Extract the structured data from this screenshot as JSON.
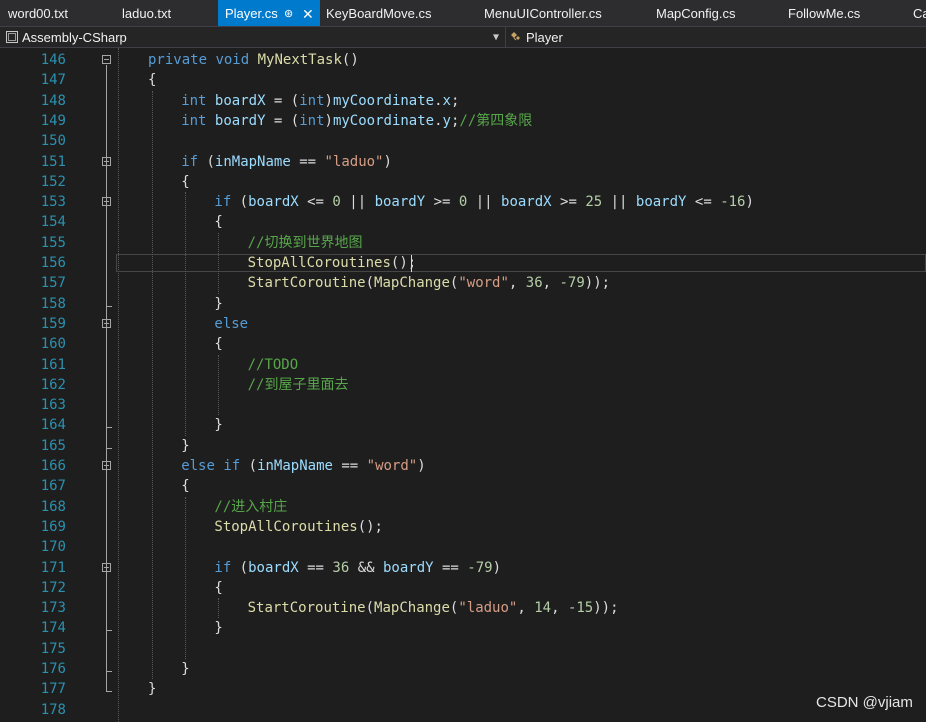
{
  "tabs": [
    {
      "label": "word00.txt",
      "active": false
    },
    {
      "label": "laduo.txt",
      "active": false
    },
    {
      "label": "Player.cs",
      "active": true
    },
    {
      "label": "KeyBoardMove.cs",
      "active": false
    },
    {
      "label": "MenuUIController.cs",
      "active": false
    },
    {
      "label": "MapConfig.cs",
      "active": false
    },
    {
      "label": "FollowMe.cs",
      "active": false
    },
    {
      "label": "Ca",
      "active": false
    }
  ],
  "tab_icons": {
    "pin": "pin-icon",
    "close": "close-icon"
  },
  "nav": {
    "project": "Assembly-CSharp",
    "member": "Player",
    "project_icon": "csharp-project-icon",
    "member_icon": "class-icon"
  },
  "colors": {
    "accent": "#007acc",
    "editor_bg": "#1e1e1e",
    "keyword": "#569cd6",
    "string": "#d69d85",
    "comment": "#57a64a",
    "line_number": "#2b91af"
  },
  "lines": [
    {
      "n": "146",
      "indent": 0,
      "tokens": [
        [
          "kw",
          "private"
        ],
        [
          "pl",
          " "
        ],
        [
          "kw",
          "void"
        ],
        [
          "pl",
          " "
        ],
        [
          "fn",
          "MyNextTask"
        ],
        [
          "pl",
          "()"
        ]
      ]
    },
    {
      "n": "147",
      "indent": 0,
      "tokens": [
        [
          "pl",
          "{"
        ]
      ]
    },
    {
      "n": "148",
      "indent": 1,
      "tokens": [
        [
          "kw",
          "int"
        ],
        [
          "pl",
          " "
        ],
        [
          "vr",
          "boardX"
        ],
        [
          "pl",
          " = ("
        ],
        [
          "kw",
          "int"
        ],
        [
          "pl",
          ")"
        ],
        [
          "vr",
          "myCoordinate"
        ],
        [
          "pl",
          "."
        ],
        [
          "vr",
          "x"
        ],
        [
          "pl",
          ";"
        ]
      ]
    },
    {
      "n": "149",
      "indent": 1,
      "tokens": [
        [
          "kw",
          "int"
        ],
        [
          "pl",
          " "
        ],
        [
          "vr",
          "boardY"
        ],
        [
          "pl",
          " = ("
        ],
        [
          "kw",
          "int"
        ],
        [
          "pl",
          ")"
        ],
        [
          "vr",
          "myCoordinate"
        ],
        [
          "pl",
          "."
        ],
        [
          "vr",
          "y"
        ],
        [
          "pl",
          ";"
        ],
        [
          "cm",
          "//第四象限"
        ]
      ]
    },
    {
      "n": "150",
      "indent": 1,
      "tokens": []
    },
    {
      "n": "151",
      "indent": 1,
      "tokens": [
        [
          "kw",
          "if"
        ],
        [
          "pl",
          " ("
        ],
        [
          "vr",
          "inMapName"
        ],
        [
          "pl",
          " == "
        ],
        [
          "str",
          "\"laduo\""
        ],
        [
          "pl",
          ")"
        ]
      ]
    },
    {
      "n": "152",
      "indent": 1,
      "tokens": [
        [
          "pl",
          "{"
        ]
      ]
    },
    {
      "n": "153",
      "indent": 2,
      "tokens": [
        [
          "kw",
          "if"
        ],
        [
          "pl",
          " ("
        ],
        [
          "vr",
          "boardX"
        ],
        [
          "pl",
          " <= "
        ],
        [
          "num",
          "0"
        ],
        [
          "pl",
          " || "
        ],
        [
          "vr",
          "boardY"
        ],
        [
          "pl",
          " >= "
        ],
        [
          "num",
          "0"
        ],
        [
          "pl",
          " || "
        ],
        [
          "vr",
          "boardX"
        ],
        [
          "pl",
          " >= "
        ],
        [
          "num",
          "25"
        ],
        [
          "pl",
          " || "
        ],
        [
          "vr",
          "boardY"
        ],
        [
          "pl",
          " <= "
        ],
        [
          "num",
          "-16"
        ],
        [
          "pl",
          ")"
        ]
      ]
    },
    {
      "n": "154",
      "indent": 2,
      "tokens": [
        [
          "pl",
          "{"
        ]
      ]
    },
    {
      "n": "155",
      "indent": 3,
      "tokens": [
        [
          "cm",
          "//切换到世界地图"
        ]
      ]
    },
    {
      "n": "156",
      "indent": 3,
      "tokens": [
        [
          "fn",
          "StopAllCoroutines"
        ],
        [
          "pl",
          "();"
        ]
      ]
    },
    {
      "n": "157",
      "indent": 3,
      "tokens": [
        [
          "fn",
          "StartCoroutine"
        ],
        [
          "pl",
          "("
        ],
        [
          "fn",
          "MapChange"
        ],
        [
          "pl",
          "("
        ],
        [
          "str",
          "\"word\""
        ],
        [
          "pl",
          ", "
        ],
        [
          "num",
          "36"
        ],
        [
          "pl",
          ", "
        ],
        [
          "num",
          "-79"
        ],
        [
          "pl",
          "));"
        ]
      ]
    },
    {
      "n": "158",
      "indent": 2,
      "tokens": [
        [
          "pl",
          "}"
        ]
      ]
    },
    {
      "n": "159",
      "indent": 2,
      "tokens": [
        [
          "kw",
          "else"
        ]
      ]
    },
    {
      "n": "160",
      "indent": 2,
      "tokens": [
        [
          "pl",
          "{"
        ]
      ]
    },
    {
      "n": "161",
      "indent": 3,
      "tokens": [
        [
          "cm",
          "//TODO"
        ]
      ]
    },
    {
      "n": "162",
      "indent": 3,
      "tokens": [
        [
          "cm",
          "//到屋子里面去"
        ]
      ]
    },
    {
      "n": "163",
      "indent": 3,
      "tokens": []
    },
    {
      "n": "164",
      "indent": 2,
      "tokens": [
        [
          "pl",
          "}"
        ]
      ]
    },
    {
      "n": "165",
      "indent": 1,
      "tokens": [
        [
          "pl",
          "}"
        ]
      ]
    },
    {
      "n": "166",
      "indent": 1,
      "tokens": [
        [
          "kw",
          "else"
        ],
        [
          "pl",
          " "
        ],
        [
          "kw",
          "if"
        ],
        [
          "pl",
          " ("
        ],
        [
          "vr",
          "inMapName"
        ],
        [
          "pl",
          " == "
        ],
        [
          "str",
          "\"word\""
        ],
        [
          "pl",
          ")"
        ]
      ]
    },
    {
      "n": "167",
      "indent": 1,
      "tokens": [
        [
          "pl",
          "{"
        ]
      ]
    },
    {
      "n": "168",
      "indent": 2,
      "tokens": [
        [
          "cm",
          "//进入村庄"
        ]
      ]
    },
    {
      "n": "169",
      "indent": 2,
      "tokens": [
        [
          "fn",
          "StopAllCoroutines"
        ],
        [
          "pl",
          "();"
        ]
      ]
    },
    {
      "n": "170",
      "indent": 2,
      "tokens": []
    },
    {
      "n": "171",
      "indent": 2,
      "tokens": [
        [
          "kw",
          "if"
        ],
        [
          "pl",
          " ("
        ],
        [
          "vr",
          "boardX"
        ],
        [
          "pl",
          " == "
        ],
        [
          "num",
          "36"
        ],
        [
          "pl",
          " && "
        ],
        [
          "vr",
          "boardY"
        ],
        [
          "pl",
          " == "
        ],
        [
          "num",
          "-79"
        ],
        [
          "pl",
          ")"
        ]
      ]
    },
    {
      "n": "172",
      "indent": 2,
      "tokens": [
        [
          "pl",
          "{"
        ]
      ]
    },
    {
      "n": "173",
      "indent": 3,
      "tokens": [
        [
          "fn",
          "StartCoroutine"
        ],
        [
          "pl",
          "("
        ],
        [
          "fn",
          "MapChange"
        ],
        [
          "pl",
          "("
        ],
        [
          "str",
          "\"laduo\""
        ],
        [
          "pl",
          ", "
        ],
        [
          "num",
          "14"
        ],
        [
          "pl",
          ", "
        ],
        [
          "num",
          "-15"
        ],
        [
          "pl",
          "));"
        ]
      ]
    },
    {
      "n": "174",
      "indent": 2,
      "tokens": [
        [
          "pl",
          "}"
        ]
      ]
    },
    {
      "n": "175",
      "indent": 2,
      "tokens": []
    },
    {
      "n": "176",
      "indent": 1,
      "tokens": [
        [
          "pl",
          "}"
        ]
      ]
    },
    {
      "n": "177",
      "indent": 0,
      "tokens": [
        [
          "pl",
          "}"
        ]
      ]
    },
    {
      "n": "178",
      "indent": 0,
      "tokens": []
    }
  ],
  "fold_markers": [
    "146",
    "151",
    "153",
    "159",
    "166",
    "171"
  ],
  "current_line": "156",
  "watermark": "CSDN @vjiam"
}
